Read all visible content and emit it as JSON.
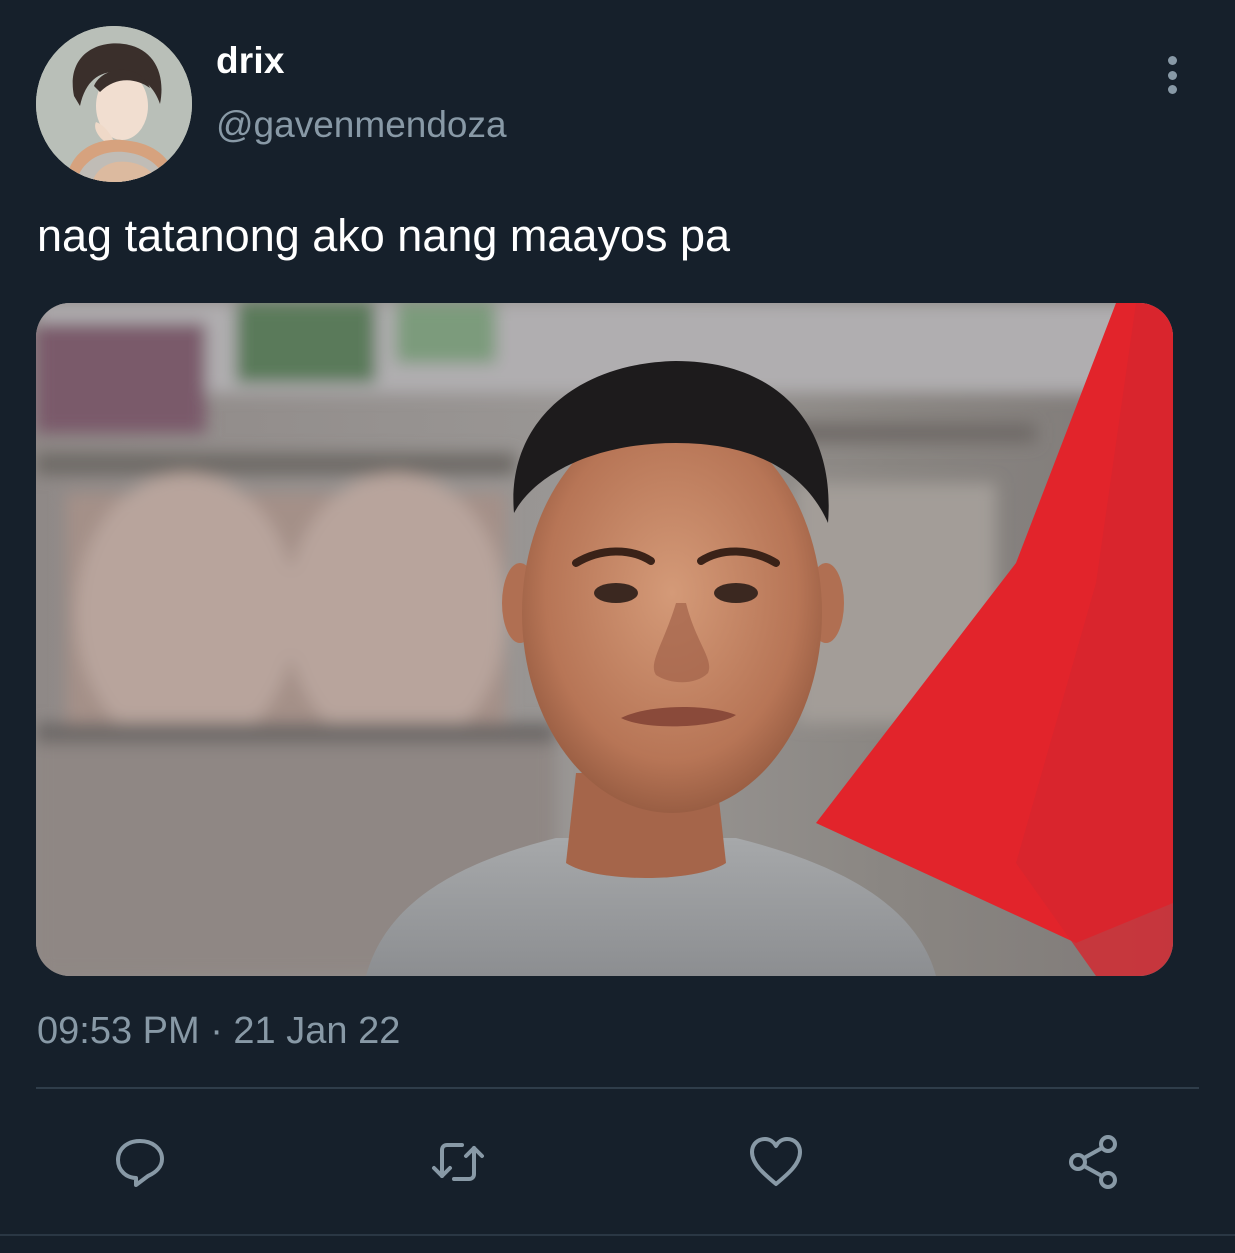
{
  "tweet": {
    "display_name": "drix",
    "handle": "@gavenmendoza",
    "text": "nag tatanong ako nang maayos pa",
    "timestamp": "09:53 PM · 21 Jan 22"
  },
  "icons": {
    "more": "more-vertical-icon",
    "reply": "reply-icon",
    "retweet": "retweet-icon",
    "like": "heart-icon",
    "share": "share-icon"
  },
  "colors": {
    "background": "#16202b",
    "primary_text": "#ffffff",
    "secondary_text": "#8899a6",
    "divider": "#2f3d4a"
  }
}
